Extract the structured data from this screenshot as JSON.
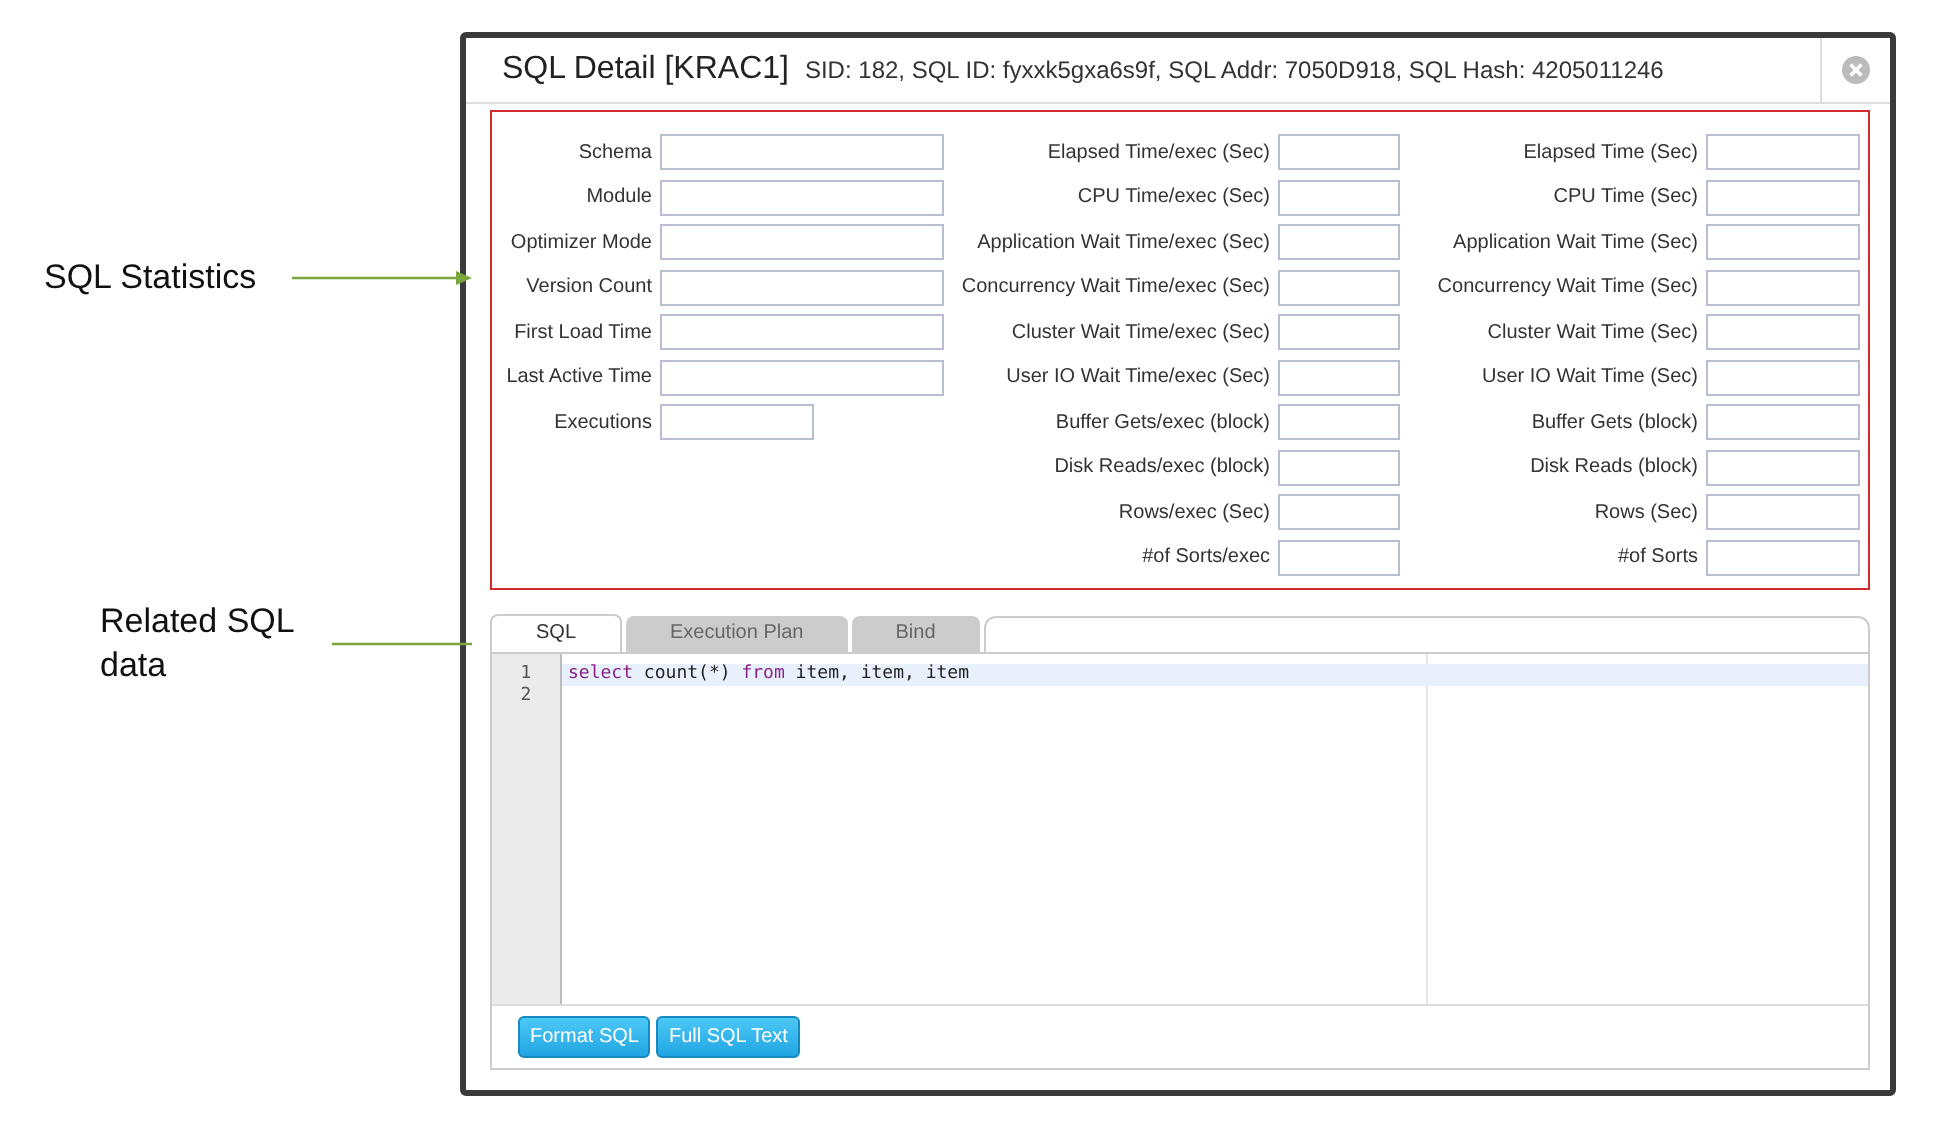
{
  "annotations": [
    {
      "text": "SQL Statistics"
    },
    {
      "text": "Related SQL data"
    }
  ],
  "dialog": {
    "title": "SQL Detail [KRAC1]",
    "subtitle": "SID: 182, SQL ID: fyxxk5gxa6s9f, SQL Addr: 7050D918, SQL Hash: 4205011246"
  },
  "statistics": {
    "columns": [
      [
        {
          "label": "Schema",
          "kind": "wide"
        },
        {
          "label": "Module",
          "kind": "wide"
        },
        {
          "label": "Optimizer Mode",
          "kind": "wide"
        },
        {
          "label": "Version Count",
          "kind": "wide"
        },
        {
          "label": "First Load Time",
          "kind": "wide"
        },
        {
          "label": "Last Active Time",
          "kind": "wide"
        },
        {
          "label": "Executions",
          "kind": "short"
        }
      ],
      [
        {
          "label": "Elapsed Time/exec (Sec)",
          "kind": "wide"
        },
        {
          "label": "CPU Time/exec (Sec)",
          "kind": "wide"
        },
        {
          "label": "Application Wait Time/exec (Sec)",
          "kind": "wide"
        },
        {
          "label": "Concurrency Wait Time/exec (Sec)",
          "kind": "wide"
        },
        {
          "label": "Cluster Wait Time/exec (Sec)",
          "kind": "wide"
        },
        {
          "label": "User IO Wait Time/exec (Sec)",
          "kind": "wide"
        },
        {
          "label": "Buffer Gets/exec (block)",
          "kind": "wide"
        },
        {
          "label": "Disk Reads/exec (block)",
          "kind": "wide"
        },
        {
          "label": "Rows/exec (Sec)",
          "kind": "wide"
        },
        {
          "label": "#of Sorts/exec",
          "kind": "wide"
        }
      ],
      [
        {
          "label": "Elapsed Time (Sec)",
          "kind": "wide"
        },
        {
          "label": "CPU Time (Sec)",
          "kind": "wide"
        },
        {
          "label": "Application Wait Time (Sec)",
          "kind": "wide"
        },
        {
          "label": "Concurrency Wait Time (Sec)",
          "kind": "wide"
        },
        {
          "label": "Cluster Wait Time (Sec)",
          "kind": "wide"
        },
        {
          "label": "User IO Wait Time (Sec)",
          "kind": "wide"
        },
        {
          "label": "Buffer Gets (block)",
          "kind": "wide"
        },
        {
          "label": "Disk Reads (block)",
          "kind": "wide"
        },
        {
          "label": "Rows (Sec)",
          "kind": "wide"
        },
        {
          "label": "#of Sorts",
          "kind": "wide"
        }
      ]
    ]
  },
  "tabs": [
    {
      "label": "SQL",
      "selected": true
    },
    {
      "label": "Execution Plan",
      "selected": false
    },
    {
      "label": "Bind",
      "selected": false
    }
  ],
  "editor": {
    "lines": [
      {
        "number": "1",
        "selected": true,
        "tokens": [
          {
            "text": "select",
            "kind": "keyword"
          },
          {
            "text": " count(*) ",
            "kind": "plain"
          },
          {
            "text": "from",
            "kind": "keyword"
          },
          {
            "text": " item, item, item",
            "kind": "plain"
          }
        ]
      },
      {
        "number": "2",
        "selected": false
      }
    ]
  },
  "buttons": [
    "Format SQL",
    "Full SQL Text"
  ]
}
